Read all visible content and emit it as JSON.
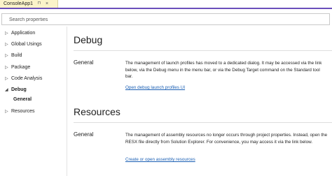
{
  "tab": {
    "title": "ConsoleApp1",
    "pin_glyph": "⊓",
    "close_glyph": "×"
  },
  "search": {
    "placeholder": "Search properties",
    "value": ""
  },
  "nav": {
    "items": [
      {
        "label": "Application",
        "icon": "chevron-right-icon",
        "glyph": "▷"
      },
      {
        "label": "Global Usings",
        "icon": "chevron-right-icon",
        "glyph": "▷"
      },
      {
        "label": "Build",
        "icon": "chevron-right-icon",
        "glyph": "▷"
      },
      {
        "label": "Package",
        "icon": "chevron-right-icon",
        "glyph": "▷"
      },
      {
        "label": "Code Analysis",
        "icon": "chevron-right-icon",
        "glyph": "▷"
      },
      {
        "label": "Debug",
        "icon": "chevron-down-icon",
        "glyph": "◢"
      },
      {
        "label": "Resources",
        "icon": "chevron-right-icon",
        "glyph": "▷"
      }
    ],
    "debug_sub": "General"
  },
  "sections": {
    "debug": {
      "title": "Debug",
      "group": "General",
      "description": "The management of launch profiles has moved to a dedicated dialog. It may be accessed via the link below, via the Debug menu in the menu bar, or via the Debug Target command on the Standard tool bar.",
      "link": "Open debug launch profiles UI"
    },
    "resources": {
      "title": "Resources",
      "group": "General",
      "description": "The management of assembly resources no longer occurs through project properties. Instead, open the RESX file directly from Solution Explorer. For convenience, you may access it via the link below.",
      "link": "Create or open assembly resources"
    }
  },
  "colors": {
    "accent": "#6b4fbb",
    "tab_background": "#fbf3c9",
    "link": "#1a5fb4"
  }
}
